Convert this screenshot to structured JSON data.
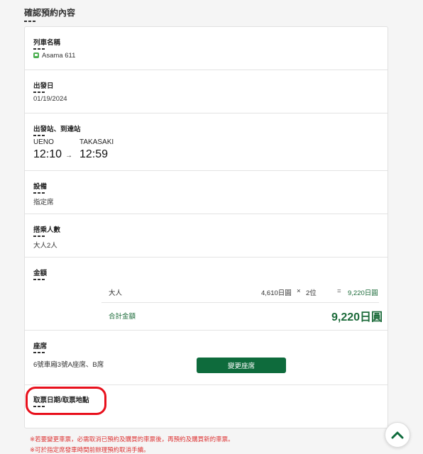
{
  "page_title": "確認預約內容",
  "sections": {
    "train": {
      "label": "列車名稱",
      "value": "Asama 611",
      "icon": "train-icon"
    },
    "date": {
      "label": "出發日",
      "value": "01/19/2024"
    },
    "stations": {
      "label": "出發站、到達站",
      "from_station": "UENO",
      "to_station": "TAKASAKI",
      "depart_time": "12:10",
      "arrive_time": "12:59",
      "arrow": "→"
    },
    "facility": {
      "label": "設備",
      "value": "指定席"
    },
    "passengers": {
      "label": "搭乘人數",
      "value": "大人2人"
    },
    "price": {
      "label": "金額",
      "row_type": "大人",
      "unit_price": "4,610日圓",
      "times": "×",
      "count": "2位",
      "equals": "=",
      "subtotal": "9,220日圓",
      "total_label": "合計金額",
      "total_amount": "9,220日圓"
    },
    "seat": {
      "label": "座席",
      "value": "6號車廂3號A座席、B席",
      "change_button": "變更座席"
    },
    "ticket_pickup": {
      "label": "取票日期/取票地點"
    }
  },
  "notes": [
    "※若要變更車票，必需取消已預約及購買的車票後，再預約及購買新的車票。",
    "※可於指定席發車時間前辦理預約取消手續。"
  ],
  "colors": {
    "accent_green": "#0e6b3c",
    "note_red": "#dd3333",
    "highlight_red": "#e8101c"
  }
}
